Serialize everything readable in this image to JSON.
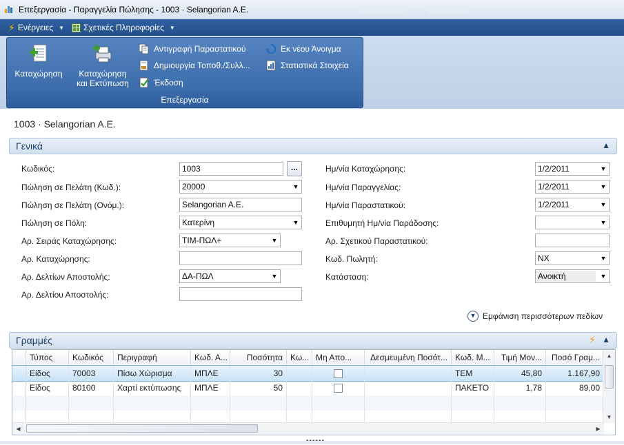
{
  "window": {
    "title": "Επεξεργασία - Παραγγελία Πώλησης - 1003 · Selangorian A.E."
  },
  "menubar": {
    "actions": "Ενέργειες",
    "related": "Σχετικές Πληροφορίες"
  },
  "ribbon": {
    "post": "Καταχώρηση",
    "post_print_1": "Καταχώρηση",
    "post_print_2": "και Εκτύπωση",
    "copy_document": "Αντιγραφή Παραστατικού",
    "create_whse": "Δημιουργία Τοποθ./Συλλ...",
    "release": "Έκδοση",
    "reopen": "Εκ νέου Άνοιγμα",
    "statistics": "Στατιστικά Στοιχεία",
    "group": "Επεξεργασία"
  },
  "page": {
    "title": "1003 · Selangorian A.E."
  },
  "general": {
    "title": "Γενικά",
    "left": [
      {
        "label": "Κωδικός:",
        "value": "1003"
      },
      {
        "label": "Πώληση σε Πελάτη (Κωδ.):",
        "value": "20000"
      },
      {
        "label": "Πώληση σε Πελάτη (Ονόμ.):",
        "value": "Selangorian A.E."
      },
      {
        "label": "Πώληση σε Πόλη:",
        "value": "Κατερίνη"
      },
      {
        "label": "Αρ. Σειράς Καταχώρησης:",
        "value": "ΤΙΜ-ΠΩΛ+"
      },
      {
        "label": "Αρ. Καταχώρησης:",
        "value": ""
      },
      {
        "label": "Αρ. Δελτίων Αποστολής:",
        "value": "ΔΑ-ΠΩΛ"
      },
      {
        "label": "Αρ. Δελτίου Αποστολής:",
        "value": ""
      }
    ],
    "right": [
      {
        "label": "Ημ/νία Καταχώρησης:",
        "value": "1/2/2011"
      },
      {
        "label": "Ημ/νία Παραγγελίας:",
        "value": "1/2/2011"
      },
      {
        "label": "Ημ/νία Παραστατικού:",
        "value": "1/2/2011"
      },
      {
        "label": "Επιθυμητή Ημ/νία Παράδοσης:",
        "value": ""
      },
      {
        "label": "Αρ. Σχετικού Παραστατικού:",
        "value": ""
      },
      {
        "label": "Κωδ. Πωλητή:",
        "value": "NX"
      },
      {
        "label": "Κατάσταση:",
        "value": "Ανοικτή"
      }
    ],
    "show_more": "Εμφάνιση περισσότερων πεδίων"
  },
  "lines": {
    "title": "Γραμμές",
    "columns": [
      "Τύπος",
      "Κωδικός",
      "Περιγραφή",
      "Κωδ. Α...",
      "Ποσότητα",
      "Κω...",
      "Μη Απο...",
      "Δεσμευμένη Ποσότ...",
      "Κωδ. Μ...",
      "Τιμή Μον...",
      "Ποσό Γραμ..."
    ],
    "rows": [
      [
        "Είδος",
        "70003",
        "Πίσω Χώρισμα",
        "ΜΠΛΕ",
        "30",
        "",
        "",
        "",
        "ΤΕΜ",
        "45,80",
        "1.167,90"
      ],
      [
        "Είδος",
        "80100",
        "Χαρτί εκτύπωσης",
        "ΜΠΛΕ",
        "50",
        "",
        "",
        "",
        "ΠΑΚΕΤΟ",
        "1,78",
        "89,00"
      ]
    ]
  },
  "colors": {
    "menubar": "#2a5894",
    "ribbon": "#4a78b6",
    "section": "#dbe6f2",
    "selected_row": "#cfe6fa"
  }
}
